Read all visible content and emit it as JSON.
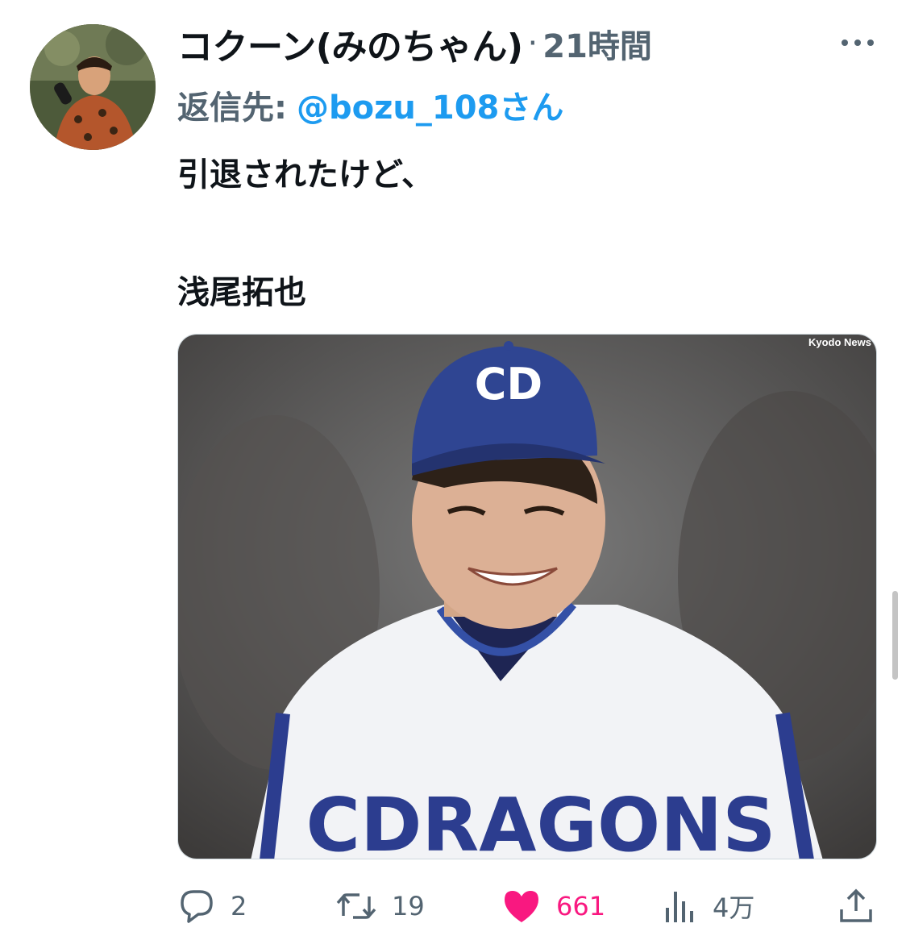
{
  "tweet": {
    "display_name": "コクーン(みのちゃん)",
    "separator": "·",
    "time": "21時間",
    "reply_prefix": "返信先:",
    "reply_handle": "@bozu_108さん",
    "text_line1": "引退されたけど、",
    "text_line2": "浅尾拓也",
    "media_credit": "Kyodo News",
    "media_icons": [
      "cap-logo",
      "jersey-lettering"
    ]
  },
  "actions": {
    "reply_count": "2",
    "retweet_count": "19",
    "like_count": "661",
    "views_count": "4万"
  },
  "icons": {
    "more": "more-icon",
    "reply": "reply-icon",
    "retweet": "retweet-icon",
    "like": "heart-icon",
    "views": "views-icon",
    "share": "share-icon"
  },
  "colors": {
    "secondary_text": "#536471",
    "link": "#1d9bf0",
    "like": "#f91880",
    "primary_text": "#0f1419"
  }
}
